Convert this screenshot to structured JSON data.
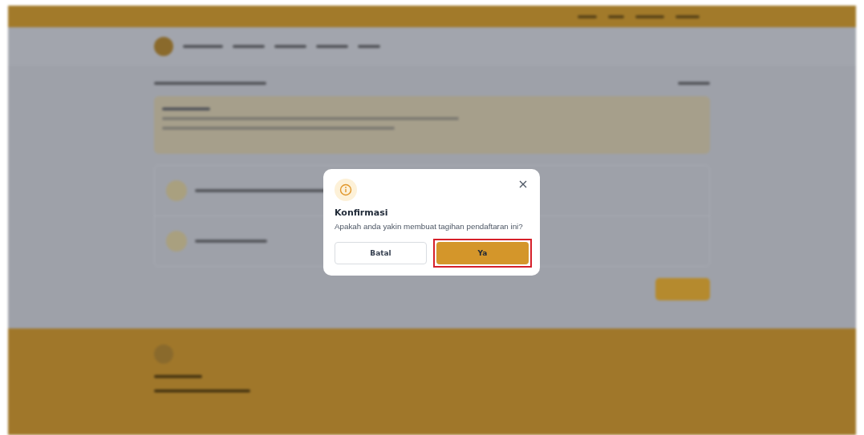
{
  "dialog": {
    "title": "Konfirmasi",
    "message": "Apakah anda yakin membuat tagihan pendaftaran ini?",
    "buttons": [
      {
        "label": "Batal",
        "kind": "secondary",
        "highlighted": false
      },
      {
        "label": "Ya",
        "kind": "primary",
        "highlighted": true
      }
    ]
  }
}
